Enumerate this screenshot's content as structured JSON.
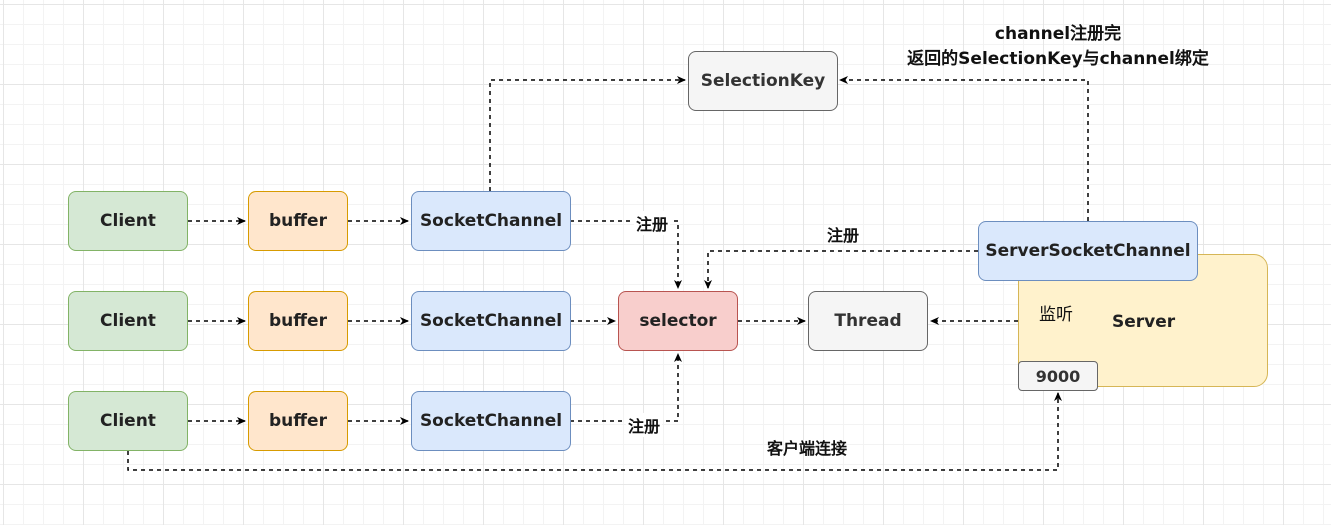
{
  "nodes": {
    "clients": [
      "Client",
      "Client",
      "Client"
    ],
    "buffers": [
      "buffer",
      "buffer",
      "buffer"
    ],
    "socket_channels": [
      "SocketChannel",
      "SocketChannel",
      "SocketChannel"
    ],
    "selector": "selector",
    "thread": "Thread",
    "selection_key": "SelectionKey",
    "server_socket_channel": "ServerSocketChannel",
    "server": "Server",
    "port": "9000"
  },
  "labels": {
    "register_top": "注册",
    "register_bottom": "注册",
    "register_server": "注册",
    "listen": "监听",
    "client_connect": "客户端连接",
    "note_line1": "channel注册完",
    "note_line2": "返回的SelectionKey与channel绑定"
  }
}
